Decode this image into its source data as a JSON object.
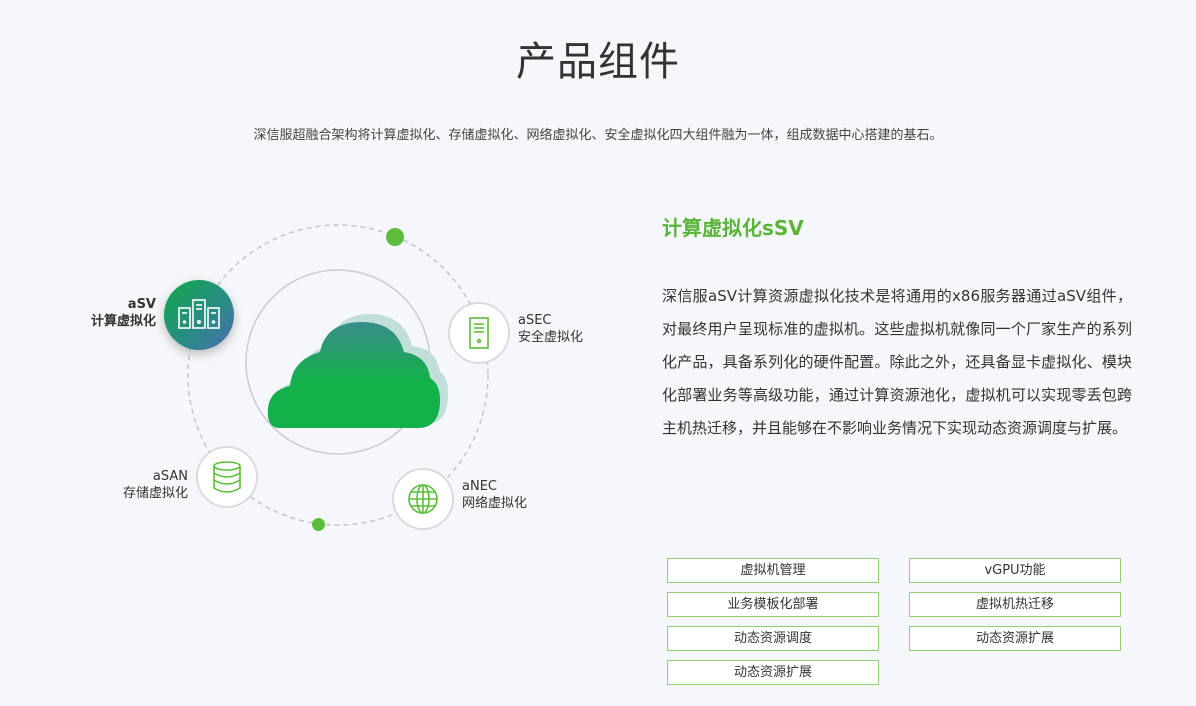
{
  "page": {
    "title": "产品组件",
    "subtitle": "深信服超融合架构将计算虚拟化、存储虚拟化、网络虚拟化、安全虚拟化四大组件融为一体，组成数据中心搭建的基石。"
  },
  "diagram": {
    "nodes": [
      {
        "code": "aSV",
        "name": "计算虚拟化",
        "icon": "server-rack-icon",
        "active": true
      },
      {
        "code": "aSEC",
        "name": "安全虚拟化",
        "icon": "security-server-icon",
        "active": false
      },
      {
        "code": "aNEC",
        "name": "网络虚拟化",
        "icon": "globe-icon",
        "active": false
      },
      {
        "code": "aSAN",
        "name": "存储虚拟化",
        "icon": "database-icon",
        "active": false
      }
    ],
    "center_icon": "cloud-icon"
  },
  "detail": {
    "title": "计算虚拟化sSV",
    "description": "深信服aSV计算资源虚拟化技术是将通用的x86服务器通过aSV组件，对最终用户呈现标准的虚拟机。这些虚拟机就像同一个厂家生产的系列化产品，具备系列化的硬件配置。除此之外，还具备显卡虚拟化、模块化部署业务等高级功能，通过计算资源池化，虚拟机可以实现零丢包跨主机热迁移，并且能够在不影响业务情况下实现动态资源调度与扩展。",
    "features": [
      "虚拟机管理",
      "vGPU功能",
      "业务模板化部署",
      "虚拟机热迁移",
      "动态资源调度",
      "动态资源扩展",
      "动态资源扩展"
    ]
  },
  "colors": {
    "accent": "#5bb43a",
    "button_border": "#8fd174",
    "cloud_green": "#14b04a",
    "cloud_teal": "#3a8d8b"
  }
}
